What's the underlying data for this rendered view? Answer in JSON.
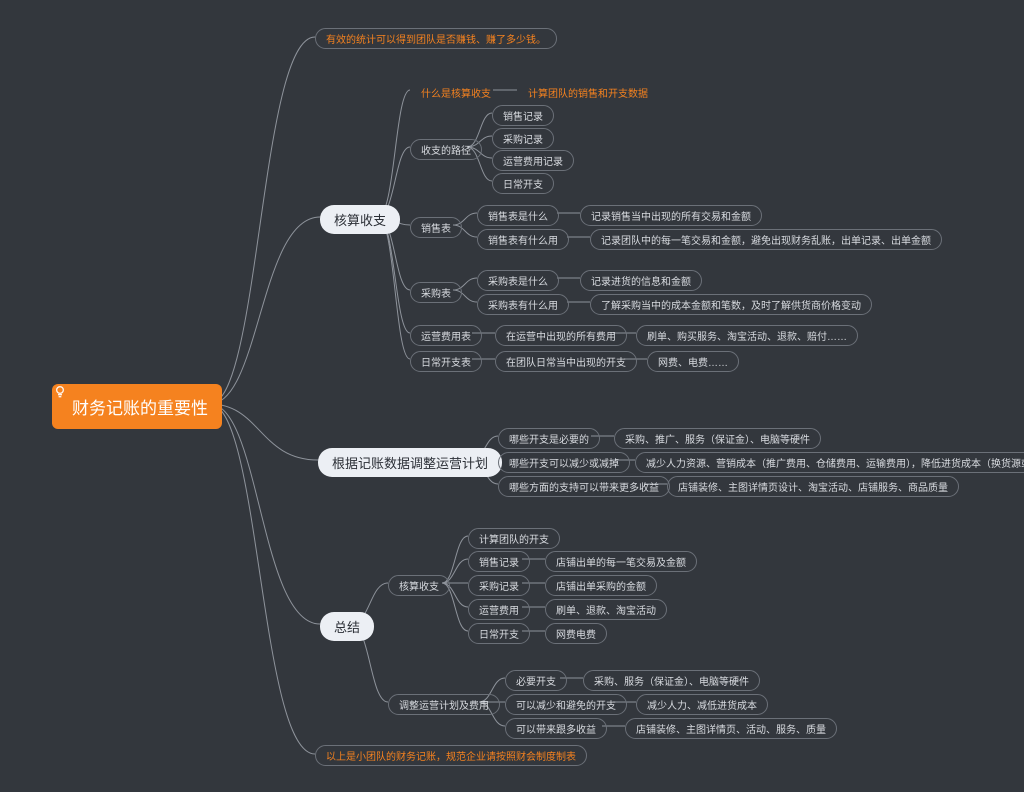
{
  "root": "财务记账的重要性",
  "b1": "有效的统计可以得到团队是否赚钱、赚了多少钱。",
  "b2": {
    "title": "核算收支",
    "a1": {
      "q": "什么是核算收支",
      "a": "计算团队的销售和开支数据"
    },
    "a2": {
      "title": "收支的路径",
      "items": [
        "销售记录",
        "采购记录",
        "运营费用记录",
        "日常开支"
      ]
    },
    "a3": {
      "title": "销售表",
      "r1": {
        "q": "销售表是什么",
        "a": "记录销售当中出现的所有交易和金额"
      },
      "r2": {
        "q": "销售表有什么用",
        "a": "记录团队中的每一笔交易和金额，避免出现财务乱账，出单记录、出单金额"
      }
    },
    "a4": {
      "title": "采购表",
      "r1": {
        "q": "采购表是什么",
        "a": "记录进货的信息和金额"
      },
      "r2": {
        "q": "采购表有什么用",
        "a": "了解采购当中的成本金额和笔数，及时了解供货商价格变动"
      }
    },
    "a5": {
      "title": "运营费用表",
      "q": "在运营中出现的所有费用",
      "a": "刷单、购买服务、淘宝活动、退款、赔付……"
    },
    "a6": {
      "title": "日常开支表",
      "q": "在团队日常当中出现的开支",
      "a": "网费、电费……"
    }
  },
  "b3": {
    "title": "根据记账数据调整运营计划",
    "r1": {
      "q": "哪些开支是必要的",
      "a": "采购、推广、服务（保证金）、电脑等硬件"
    },
    "r2": {
      "q": "哪些开支可以减少或减掉",
      "a": "减少人力资源、营销成本（推广费用、仓储费用、运输费用），降低进货成本（换货源或和货源谈判）"
    },
    "r3": {
      "q": "哪些方面的支持可以带来更多收益",
      "a": "店铺装修、主图详情页设计、淘宝活动、店铺服务、商品质量"
    }
  },
  "b4": {
    "title": "总结",
    "s1": {
      "title": "核算收支",
      "items": [
        {
          "t": "计算团队的开支"
        },
        {
          "t": "销售记录",
          "d": "店铺出单的每一笔交易及金额"
        },
        {
          "t": "采购记录",
          "d": "店铺出单采购的金额"
        },
        {
          "t": "运营费用",
          "d": "刷单、退款、淘宝活动"
        },
        {
          "t": "日常开支",
          "d": "网费电费"
        }
      ]
    },
    "s2": {
      "title": "调整运营计划及费用",
      "items": [
        {
          "t": "必要开支",
          "d": "采购、服务（保证金）、电脑等硬件"
        },
        {
          "t": "可以减少和避免的开支",
          "d": "减少人力、减低进货成本"
        },
        {
          "t": "可以带来跟多收益",
          "d": "店铺装修、主图详情页、活动、服务、质量"
        }
      ]
    }
  },
  "b5": "以上是小团队的财务记账，规范企业请按照财会制度制表"
}
